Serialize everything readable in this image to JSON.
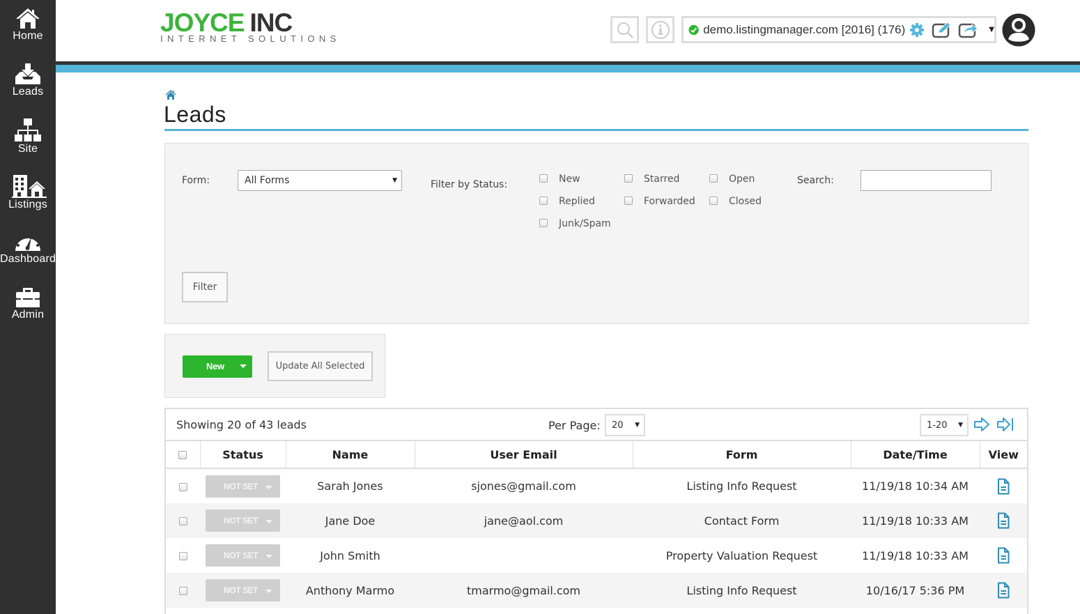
{
  "sidebar": {
    "items": [
      {
        "label": "Home",
        "icon": "home-icon"
      },
      {
        "label": "Leads",
        "icon": "inbox-download-icon"
      },
      {
        "label": "Site",
        "icon": "sitemap-icon"
      },
      {
        "label": "Listings",
        "icon": "buildings-house-icon"
      },
      {
        "label": "Dashboard",
        "icon": "gauge-icon"
      },
      {
        "label": "Admin",
        "icon": "toolbox-icon"
      }
    ]
  },
  "header": {
    "logo_primary": "JOYCE",
    "logo_secondary": "INC",
    "logo_tagline": "INTERNET SOLUTIONS",
    "site_selector": "demo.listingmanager.com [2016] (176)",
    "colors": {
      "accent_blue": "#53b6da",
      "brand_green": "#3cb43c",
      "sidebar": "#303030"
    }
  },
  "page": {
    "title": "Leads"
  },
  "filter": {
    "form_label": "Form:",
    "form_value": "All Forms",
    "status_label": "Filter by Status:",
    "statuses": [
      "New",
      "Starred",
      "Open",
      "Replied",
      "Forwarded",
      "Closed",
      "Junk/Spam"
    ],
    "search_label": "Search:",
    "search_value": "",
    "filter_button": "Filter"
  },
  "actions": {
    "new_button": "New",
    "update_button": "Update All Selected"
  },
  "table": {
    "showing_text": "Showing 20 of 43 leads",
    "per_page_label": "Per Page:",
    "per_page_value": "20",
    "range_value": "1-20",
    "columns": [
      "Status",
      "Name",
      "User Email",
      "Form",
      "Date/Time",
      "View"
    ],
    "rows": [
      {
        "status": "NOT SET",
        "name": "Sarah Jones",
        "email": "sjones@gmail.com",
        "form": "Listing Info Request",
        "datetime": "11/19/18 10:34 AM"
      },
      {
        "status": "NOT SET",
        "name": "Jane Doe",
        "email": "jane@aol.com",
        "form": "Contact Form",
        "datetime": "11/19/18 10:33 AM"
      },
      {
        "status": "NOT SET",
        "name": "John Smith",
        "email": "",
        "form": "Property Valuation Request",
        "datetime": "11/19/18 10:33 AM"
      },
      {
        "status": "NOT SET",
        "name": "Anthony Marmo",
        "email": "tmarmo@gmail.com",
        "form": "Listing Info Request",
        "datetime": "10/16/17 5:36 PM"
      }
    ]
  }
}
